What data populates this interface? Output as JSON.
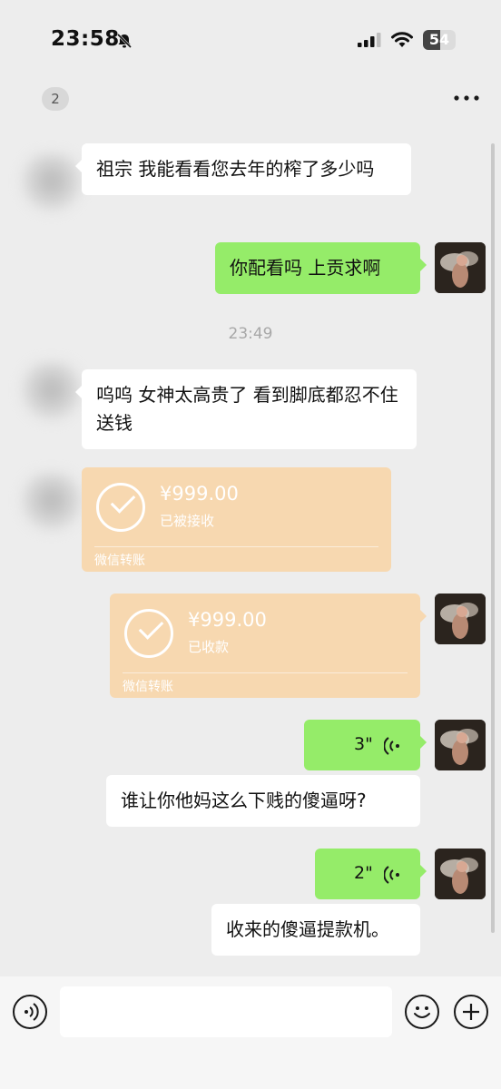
{
  "status_bar": {
    "time": "23:58",
    "battery_level": "54",
    "battery_fraction": 0.54
  },
  "header": {
    "unread_badge": "2",
    "more_icon": "more-dots-icon"
  },
  "messages": [
    {
      "side": "in",
      "type": "text",
      "text": "祖宗 我能看看您去年的榨了多少吗"
    },
    {
      "side": "out",
      "type": "text",
      "text": "你配看吗 上贡求啊"
    },
    {
      "type": "time",
      "text": "23:49"
    },
    {
      "side": "in",
      "type": "text",
      "text": "呜呜 女神太高贵了 看到脚底都忍不住送钱"
    },
    {
      "side": "in",
      "type": "transfer",
      "amount": "¥999.00",
      "status": "已被接收",
      "label": "微信转账"
    },
    {
      "side": "out",
      "type": "transfer",
      "amount": "¥999.00",
      "status": "已收款",
      "label": "微信转账"
    },
    {
      "side": "out",
      "type": "voice",
      "duration": "3\""
    },
    {
      "side": "out",
      "type": "text",
      "text": "谁让你他妈这么下贱的傻逼呀?"
    },
    {
      "side": "out",
      "type": "voice",
      "duration": "2\""
    },
    {
      "side": "out",
      "type": "text",
      "text": "收来的傻逼提款机。"
    }
  ],
  "input_bar": {
    "voice_icon": "voice-input-icon",
    "emoji_icon": "emoji-icon",
    "plus_icon": "plus-icon"
  },
  "colors": {
    "background": "#ededed",
    "outgoing_bubble": "#95ec69",
    "incoming_bubble": "#ffffff",
    "transfer_card": "#f7d8b0"
  }
}
